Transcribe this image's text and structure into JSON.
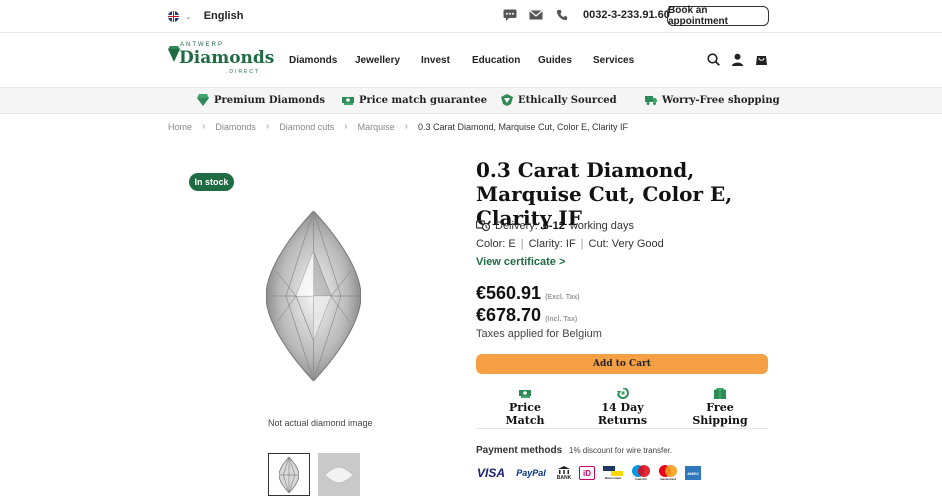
{
  "topbar": {
    "language": "English",
    "phone": "0032-3-233.91.60",
    "appointment_label": "Book an appointment"
  },
  "logo": {
    "small": "ANTWERP",
    "big": "Diamonds",
    "direct": ".DIRECT"
  },
  "nav": [
    "Diamonds",
    "Jewellery",
    "Invest",
    "Education",
    "Guides",
    "Services"
  ],
  "usp": [
    "Premium Diamonds",
    "Price match guarantee",
    "Ethically Sourced",
    "Worry-Free shopping"
  ],
  "breadcrumb": [
    "Home",
    "Diamonds",
    "Diamond cuts",
    "Marquise",
    "0.3 Carat Diamond, Marquise Cut, Color E, Clarity IF"
  ],
  "gallery": {
    "badge": "In stock",
    "caption": "Not actual diamond image"
  },
  "product": {
    "title": "0.3 Carat Diamond, Marquise Cut, Color E, Clarity IF",
    "delivery_prefix": "Delivery:",
    "delivery_days": "6-12",
    "delivery_suffix": "working days",
    "color": "Color: E",
    "clarity": "Clarity: IF",
    "cut": "Cut: Very Good",
    "certificate_link": "View certificate >",
    "price_excl": "€560.91",
    "price_excl_note": "(Excl. Tax)",
    "price_incl": "€678.70",
    "price_incl_note": "(Incl. Tax)",
    "tax_note": "Taxes applied for Belgium",
    "add_to_cart": "Add to Cart"
  },
  "perks": [
    "Price Match",
    "14 Day Returns",
    "Free Shipping"
  ],
  "payment": {
    "title": "Payment methods",
    "note": "1% discount for wire transfer.",
    "logos": [
      "VISA",
      "PayPal",
      "BANK",
      "iD",
      "Bancontact",
      "maestro",
      "mastercard",
      "AMEX"
    ]
  },
  "colors": {
    "brand_green": "#1f6b43",
    "cart_orange": "#f6a045"
  }
}
